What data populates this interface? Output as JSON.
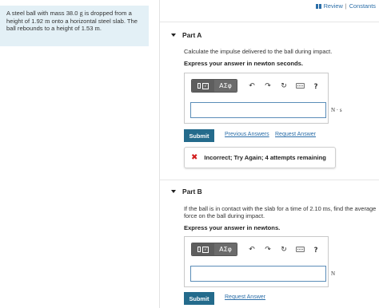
{
  "problem": {
    "line1": "A steel ball with mass 38.0 ",
    "mass_unit": "g",
    "line1b": " is dropped from a",
    "line2": "height of 1.92 ",
    "height_unit": "m",
    "line2b": " onto a horizontal steel slab. The",
    "line3": "ball rebounds to a height of 1.53 ",
    "rebound_unit": "m",
    "line3b": "."
  },
  "topbar": {
    "review_label": "Review",
    "separator": "|",
    "constants_label": "Constants"
  },
  "part_a": {
    "title": "Part A",
    "prompt": "Calculate the impulse delivered to the ball during impact.",
    "express": "Express your answer in newton seconds.",
    "toolbar": {
      "greek_label": "ΑΣφ",
      "undo": "↶",
      "redo": "↷",
      "reset": "↻",
      "help": "?"
    },
    "input_value": "",
    "unit": "N · s",
    "submit_label": "Submit",
    "previous_answers_label": "Previous Answers",
    "request_answer_label": "Request Answer",
    "feedback_icon": "✖",
    "feedback_text": "Incorrect; Try Again; 4 attempts remaining"
  },
  "part_b": {
    "title": "Part B",
    "prompt_line1_pre": "If the ball is in contact with the slab for a time of 2.10 ",
    "time_unit": "ms",
    "prompt_line1_post": ", find the average",
    "prompt_line2": "force on the ball during impact.",
    "express": "Express your answer in newtons.",
    "toolbar": {
      "greek_label": "ΑΣφ",
      "undo": "↶",
      "redo": "↷",
      "reset": "↻",
      "help": "?"
    },
    "input_value": "",
    "unit": "N",
    "submit_label": "Submit",
    "request_answer_label": "Request Answer"
  },
  "colors": {
    "problem_bg": "#e3f0f6",
    "link": "#2b6ea8",
    "submit_bg": "#246b8c",
    "error": "#d21d1d"
  }
}
